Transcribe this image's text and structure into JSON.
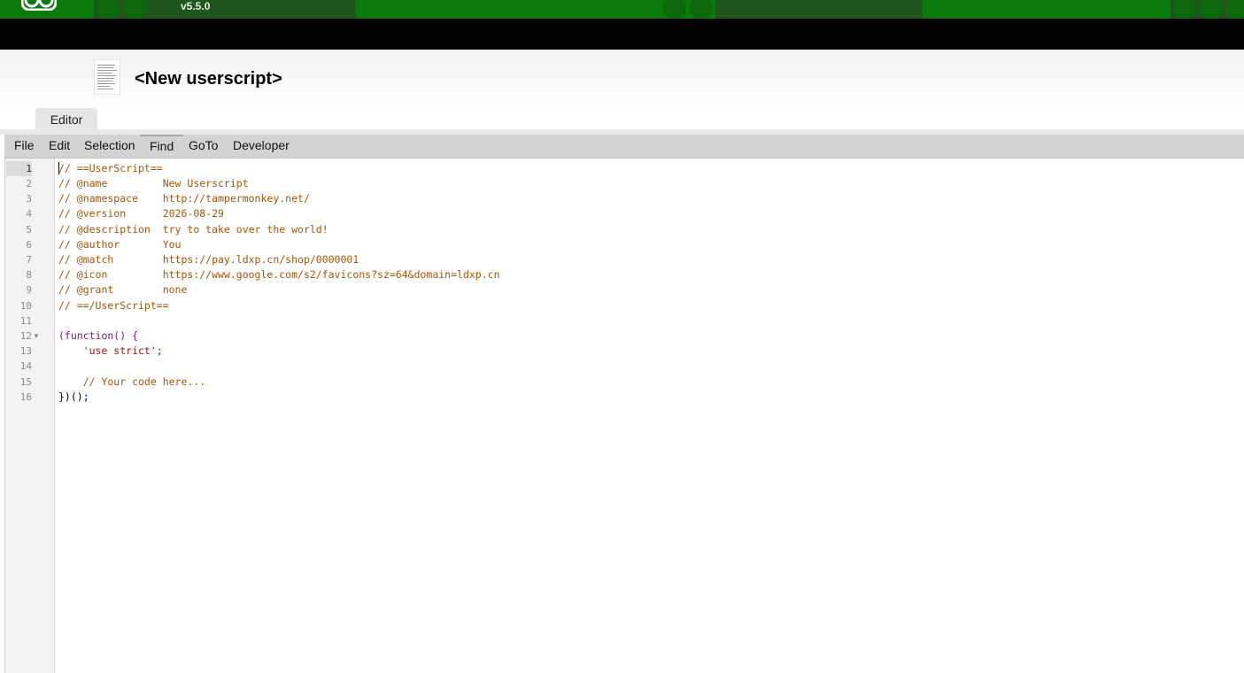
{
  "app": {
    "version": "v5.5.0",
    "script_title": "<New userscript>",
    "tab_label": "Editor"
  },
  "menu": {
    "items": [
      "File",
      "Edit",
      "Selection",
      "Find",
      "GoTo",
      "Developer"
    ],
    "active": "Find"
  },
  "editor": {
    "current_line": 1,
    "lines": [
      {
        "n": "1",
        "text": "// ==UserScript=="
      },
      {
        "n": "2",
        "text": "// @name         New Userscript"
      },
      {
        "n": "3",
        "text": "// @namespace    http://tampermonkey.net/"
      },
      {
        "n": "4",
        "text": "// @version      2026-08-29"
      },
      {
        "n": "5",
        "text": "// @description  try to take over the world!"
      },
      {
        "n": "6",
        "text": "// @author       You"
      },
      {
        "n": "7",
        "text": "// @match        https://pay.ldxp.cn/shop/0000001"
      },
      {
        "n": "8",
        "text": "// @icon         https://www.google.com/s2/favicons?sz=64&domain=ldxp.cn"
      },
      {
        "n": "9",
        "text": "// @grant        none"
      },
      {
        "n": "10",
        "text": "// ==/UserScript=="
      },
      {
        "n": "11",
        "text": ""
      },
      {
        "n": "12",
        "text": "(function() {"
      },
      {
        "n": "13",
        "text": "    'use strict';"
      },
      {
        "n": "14",
        "text": ""
      },
      {
        "n": "15",
        "text": "    // Your code here..."
      },
      {
        "n": "16",
        "text": "})();"
      }
    ]
  },
  "colors": {
    "banner_green": "#0a7a0a",
    "comment": "#a0550a",
    "keyword": "#7a1a8a",
    "string": "#a01515"
  }
}
